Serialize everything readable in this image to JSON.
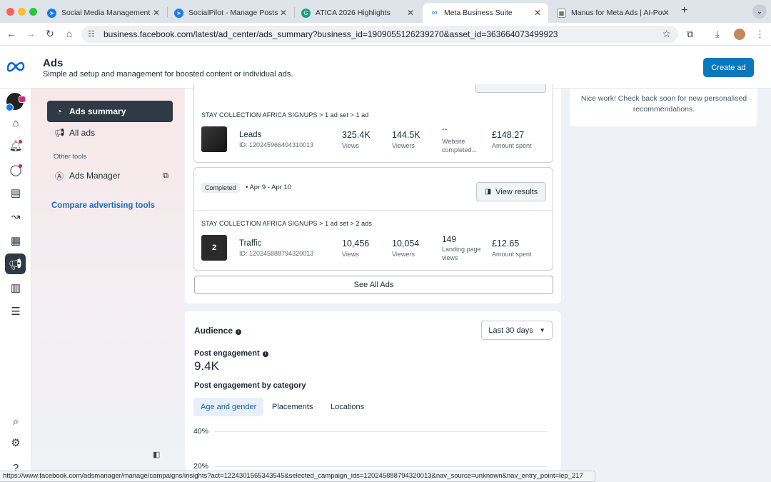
{
  "browser": {
    "tabs": [
      {
        "title": "Social Media Management an",
        "icon": "socialpilot-icon"
      },
      {
        "title": "SocialPilot - Manage Posts",
        "icon": "socialpilot-icon"
      },
      {
        "title": "ATICA 2026 Highlights",
        "icon": "grammarly-icon"
      },
      {
        "title": "Meta Business Suite",
        "icon": "meta-icon",
        "active": true
      },
      {
        "title": "Manus for Meta Ads | AI-Pow",
        "icon": "manus-icon"
      }
    ],
    "url": "business.facebook.com/latest/ad_center/ads_summary?business_id=1909055126239270&asset_id=363664073499923",
    "status_url": "https://www.facebook.com/adsmanager/manage/campaigns/insights?act=1224301565343545&selected_campaign_ids=120245888794320013&nav_source=unknown&nav_entry_point=lep_217"
  },
  "header": {
    "title": "Ads",
    "subtitle": "Simple ad setup and management for boosted content or individual ads.",
    "create_label": "Create ad"
  },
  "sidebar": {
    "items": [
      {
        "label": "Ads summary",
        "icon": "ads-summary-icon",
        "selected": true
      },
      {
        "label": "All ads",
        "icon": "megaphone-icon"
      }
    ],
    "other_tools_label": "Other tools",
    "ads_manager_label": "Ads Manager",
    "compare_label": "Compare advertising tools"
  },
  "ads": [
    {
      "breadcrumb": "STAY COLLECTION AFRICA SIGNUPS > 1 ad set > 1 ad",
      "objective": "Leads",
      "id": "ID: 120245966404310013",
      "m1_value": "325.4K",
      "m1_label": "Views",
      "m2_value": "144.5K",
      "m2_label": "Viewers",
      "m3_value": "--",
      "m3_label": "Website completed...",
      "spent_value": "£148.27",
      "spent_label": "Amount spent"
    },
    {
      "status": "Completed",
      "dates": "Apr 9 - Apr 10",
      "view_results_label": "View results",
      "breadcrumb": "STAY COLLECTION AFRICA SIGNUPS > 1 ad set > 2 ads",
      "thumb_count": "2",
      "objective": "Traffic",
      "id": "ID: 120245888794320013",
      "m1_value": "10,456",
      "m1_label": "Views",
      "m2_value": "10,054",
      "m2_label": "Viewers",
      "m3_value": "149",
      "m3_label": "Landing page views",
      "spent_value": "£12.65",
      "spent_label": "Amount spent"
    }
  ],
  "see_all_label": "See All Ads",
  "audience": {
    "title": "Audience",
    "range_label": "Last 30 days",
    "engagement_label": "Post engagement",
    "engagement_value": "9.4K",
    "by_category_label": "Post engagement by category",
    "tabs": [
      "Age and gender",
      "Placements",
      "Locations"
    ],
    "selected_tab": 0,
    "y_ticks": [
      "40%",
      "20%"
    ]
  },
  "recommendations": {
    "text": "Nice work! Check back soon for new personalised recommendations."
  },
  "colors": {
    "primary_button": "#0a78be",
    "nav_selected": "#2f3a44",
    "link": "#1a6fb8",
    "notification_dot": "#e41e3f"
  }
}
